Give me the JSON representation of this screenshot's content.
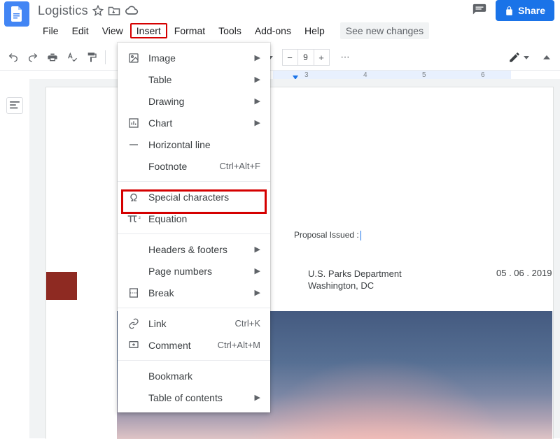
{
  "title": "Logistics",
  "share_label": "Share",
  "menubar": {
    "file": "File",
    "edit": "Edit",
    "view": "View",
    "insert": "Insert",
    "format": "Format",
    "tools": "Tools",
    "addons": "Add-ons",
    "help": "Help",
    "see_changes": "See new changes"
  },
  "toolbar": {
    "zoom_value": "9"
  },
  "ruler": {
    "n3": "3",
    "n4": "4",
    "n5": "5",
    "n6": "6"
  },
  "insert_menu": {
    "image": "Image",
    "table": "Table",
    "drawing": "Drawing",
    "chart": "Chart",
    "hr": "Horizontal line",
    "footnote": "Footnote",
    "footnote_sc": "Ctrl+Alt+F",
    "special": "Special characters",
    "equation": "Equation",
    "headers": "Headers & footers",
    "page_numbers": "Page numbers",
    "break": "Break",
    "link": "Link",
    "link_sc": "Ctrl+K",
    "comment": "Comment",
    "comment_sc": "Ctrl+Alt+M",
    "bookmark": "Bookmark",
    "toc": "Table of contents"
  },
  "doc": {
    "proposal": "Proposal Issued :",
    "dept": "U.S. Parks Department",
    "city": "Washington, DC",
    "date": "05 . 06 . 2019"
  }
}
